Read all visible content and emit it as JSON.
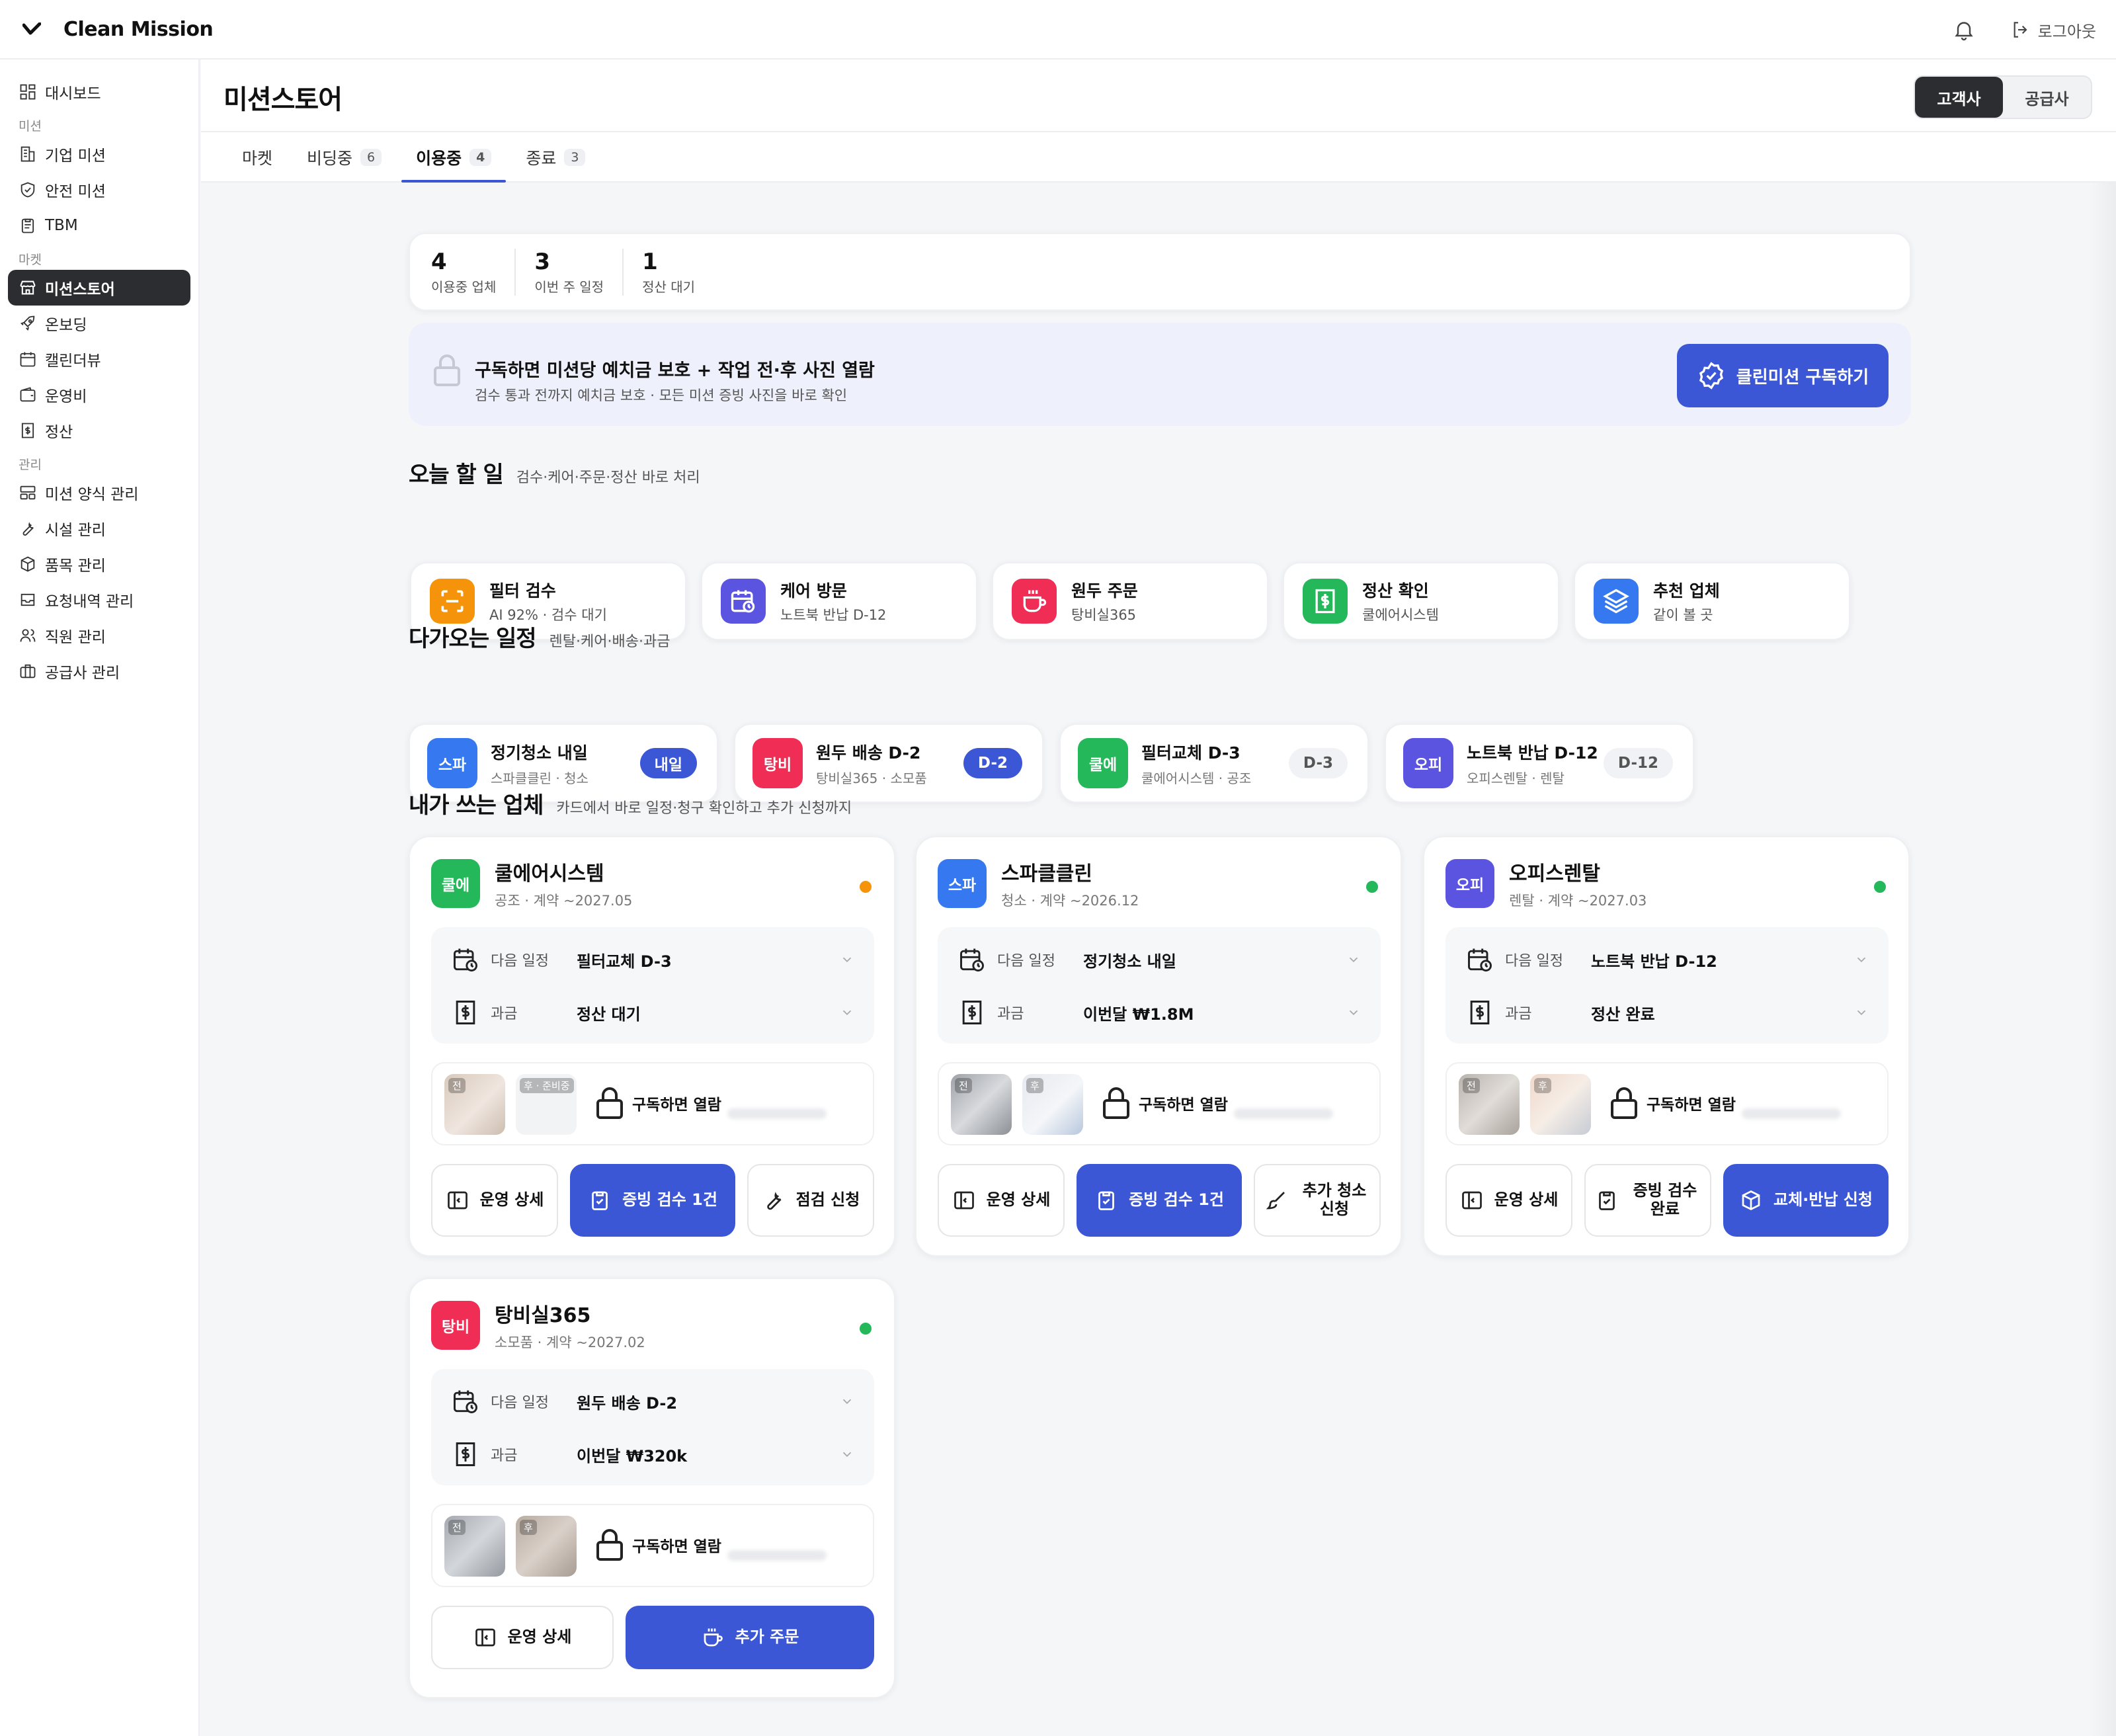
{
  "app": {
    "name": "Clean Mission",
    "logout_label": "로그아웃"
  },
  "sidebar": {
    "dashboard": "대시보드",
    "group_mission": "미션",
    "corp_mission": "기업 미션",
    "safety_mission": "안전 미션",
    "tbm": "TBM",
    "group_market": "마켓",
    "mission_store": "미션스토어",
    "onboarding": "온보딩",
    "calendar": "캘린더뷰",
    "opex": "운영비",
    "settlement": "정산",
    "group_manage": "관리",
    "form_manage": "미션 양식 관리",
    "facility_manage": "시설 관리",
    "item_manage": "품목 관리",
    "request_manage": "요청내역 관리",
    "staff_manage": "직원 관리",
    "supplier_manage": "공급사 관리"
  },
  "header": {
    "title": "미션스토어",
    "toggle_customer": "고객사",
    "toggle_supplier": "공급사"
  },
  "tabs": [
    {
      "label": "마켓",
      "count": ""
    },
    {
      "label": "비딩중",
      "count": "6"
    },
    {
      "label": "이용중",
      "count": "4"
    },
    {
      "label": "종료",
      "count": "3"
    }
  ],
  "stats": [
    {
      "num": "4",
      "label": "이용중 업체"
    },
    {
      "num": "3",
      "label": "이번 주 일정"
    },
    {
      "num": "1",
      "label": "정산 대기"
    }
  ],
  "banner": {
    "title": "구독하면 미션당 예치금 보호 + 작업 전·후 사진 열람",
    "sub": "검수 통과 전까지 예치금 보호 · 모든 미션 증빙 사진을 바로 확인",
    "button": "클린미션 구독하기"
  },
  "today": {
    "title": "오늘 할 일",
    "sub": "검수·케어·주문·정산 바로 처리",
    "items": [
      {
        "title": "필터 검수",
        "sub": "AI 92% · 검수 대기",
        "icon": "scan-icon",
        "color": "#f5930b"
      },
      {
        "title": "케어 방문",
        "sub": "노트북 반납 D-12",
        "icon": "calendar-clock-icon",
        "color": "#5b54e0"
      },
      {
        "title": "원두 주문",
        "sub": "탕비실365",
        "icon": "cup-icon",
        "color": "#ef2d55"
      },
      {
        "title": "정산 확인",
        "sub": "쿨에어시스템",
        "icon": "receipt-icon",
        "color": "#24b85a"
      },
      {
        "title": "추천 업체",
        "sub": "같이 볼 곳",
        "icon": "layers-icon",
        "color": "#3578f0"
      }
    ]
  },
  "upcoming": {
    "title": "다가오는 일정",
    "sub": "렌탈·케어·배송·과금",
    "items": [
      {
        "avatar": "스파",
        "color": "#3578f0",
        "title": "정기청소 내일",
        "sub": "스파클클린 · 청소",
        "badge": "내일",
        "hot": true
      },
      {
        "avatar": "탕비",
        "color": "#ef2d55",
        "title": "원두 배송 D-2",
        "sub": "탕비실365 · 소모품",
        "badge": "D-2",
        "hot": true
      },
      {
        "avatar": "쿨에",
        "color": "#24b85a",
        "title": "필터교체 D-3",
        "sub": "쿨에어시스템 · 공조",
        "badge": "D-3",
        "hot": false
      },
      {
        "avatar": "오피",
        "color": "#5b54e0",
        "title": "노트북 반납 D-12",
        "sub": "오피스렌탈 · 렌탈",
        "badge": "D-12",
        "hot": false
      }
    ]
  },
  "vendors": {
    "title": "내가 쓰는 업체",
    "sub": "카드에서 바로 일정·청구 확인하고 추가 신청까지",
    "next_label": "다음 일정",
    "billing_label": "과금",
    "lock_label": "구독하면 열람",
    "cards": [
      {
        "avatar": "쿨에",
        "color": "#24b85a",
        "name": "쿨에어시스템",
        "meta": "공조 · 계약 ~2027.05",
        "status_color": "#f5930b",
        "next": "필터교체 D-3",
        "billing": "정산 대기",
        "thumb1": "전",
        "thumb2": "후 · 준비중",
        "actions": [
          "운영 상세",
          "증빙 검수 1건",
          "점검 신청"
        ]
      },
      {
        "avatar": "스파",
        "color": "#3578f0",
        "name": "스파클클린",
        "meta": "청소 · 계약 ~2026.12",
        "status_color": "#24b85a",
        "next": "정기청소 내일",
        "billing": "이번달 ₩1.8M",
        "thumb1": "전",
        "thumb2": "후",
        "actions": [
          "운영 상세",
          "증빙 검수 1건",
          "추가 청소 신청"
        ]
      },
      {
        "avatar": "오피",
        "color": "#5b54e0",
        "name": "오피스렌탈",
        "meta": "렌탈 · 계약 ~2027.03",
        "status_color": "#24b85a",
        "next": "노트북 반납 D-12",
        "billing": "정산 완료",
        "thumb1": "전",
        "thumb2": "후",
        "actions": [
          "운영 상세",
          "증빙 검수 완료",
          "교체·반납 신청"
        ]
      },
      {
        "avatar": "탕비",
        "color": "#ef2d55",
        "name": "탕비실365",
        "meta": "소모품 · 계약 ~2027.02",
        "status_color": "#24b85a",
        "next": "원두 배송 D-2",
        "billing": "이번달 ₩320k",
        "thumb1": "전",
        "thumb2": "후",
        "actions": [
          "운영 상세",
          "추가 주문"
        ]
      }
    ]
  }
}
